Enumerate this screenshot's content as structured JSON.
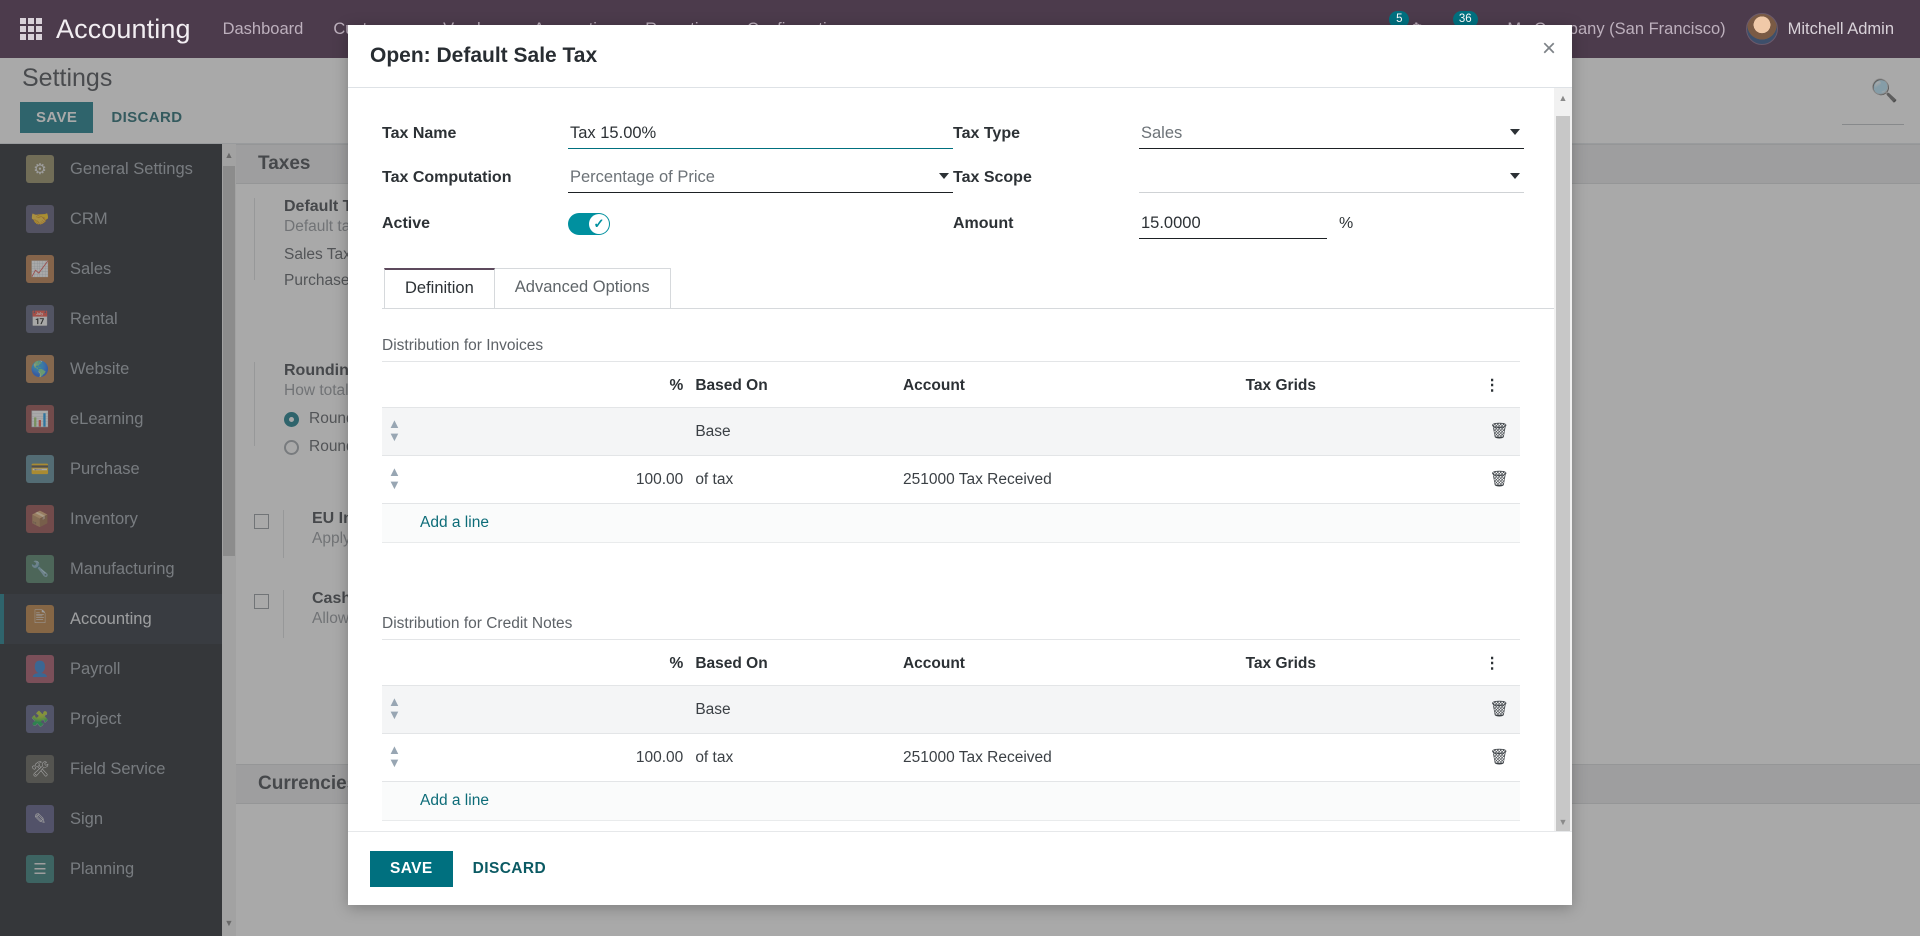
{
  "navbar": {
    "apps_icon": "apps-grid-icon",
    "brand": "Accounting",
    "menu": [
      "Dashboard",
      "Customers",
      "Vendors",
      "Accounting",
      "Reporting",
      "Configuration"
    ],
    "messages_badge": "5",
    "activities_icon": "clock-icon",
    "updates_badge": "36",
    "shortcut_icon": "scissors-icon",
    "company": "My Company (San Francisco)",
    "user": "Mitchell Admin"
  },
  "control_panel": {
    "title": "Settings",
    "save_label": "SAVE",
    "discard_label": "DISCARD",
    "search_icon": "search-icon"
  },
  "sidebar": {
    "items": [
      {
        "label": "General Settings",
        "icon": "gear-icon",
        "color": "#8a8255",
        "active": false
      },
      {
        "label": "CRM",
        "icon": "handshake-icon",
        "color": "#4b4a6b",
        "active": false
      },
      {
        "label": "Sales",
        "icon": "chart-up-icon",
        "color": "#b5703a",
        "active": false
      },
      {
        "label": "Rental",
        "icon": "calendar-icon",
        "color": "#4a4f6e",
        "active": false
      },
      {
        "label": "Website",
        "icon": "globe-icon",
        "color": "#b57842",
        "active": false
      },
      {
        "label": "eLearning",
        "icon": "presentation-icon",
        "color": "#8c3b3b",
        "active": false
      },
      {
        "label": "Purchase",
        "icon": "card-icon",
        "color": "#4c7f91",
        "active": false
      },
      {
        "label": "Inventory",
        "icon": "box-icon",
        "color": "#8c3b3b",
        "active": false
      },
      {
        "label": "Manufacturing",
        "icon": "wrench-icon",
        "color": "#3f7458",
        "active": false
      },
      {
        "label": "Accounting",
        "icon": "invoice-icon",
        "color": "#b5732f",
        "active": true
      },
      {
        "label": "Payroll",
        "icon": "person-pay-icon",
        "color": "#a04458",
        "active": false
      },
      {
        "label": "Project",
        "icon": "puzzle-icon",
        "color": "#4a4f7a",
        "active": false
      },
      {
        "label": "Field Service",
        "icon": "tools-icon",
        "color": "#4f4f45",
        "active": false
      },
      {
        "label": "Sign",
        "icon": "signature-icon",
        "color": "#4a4a7a",
        "active": false
      },
      {
        "label": "Planning",
        "icon": "timeline-icon",
        "color": "#1f6f6b",
        "active": false
      }
    ]
  },
  "settings_page": {
    "section_taxes": "Taxes",
    "blocks": [
      {
        "title": "Default Taxes",
        "subtitle": "Default taxes applied to local transactions",
        "lines": [
          "Sales Tax",
          "Purchase Tax"
        ]
      },
      {
        "title": "Rounding Method",
        "subtitle": "How total tax amount is computed in orders and invoices",
        "options": [
          "Round per Line",
          "Round Globally"
        ],
        "selected_index": 0
      },
      {
        "title": "EU Intra-community Distance Selling",
        "subtitle": "Apply VAT of the EU country to which goods are delivered."
      },
      {
        "title": "Cash Basis",
        "subtitle": "Allow to configure taxes using cash basis"
      }
    ],
    "section_currencies": "Currencies"
  },
  "modal": {
    "title": "Open: Default Sale Tax",
    "close_icon": "close-icon",
    "fields": {
      "tax_name_label": "Tax Name",
      "tax_name_value": "Tax 15.00%",
      "tax_computation_label": "Tax Computation",
      "tax_computation_value": "Percentage of Price",
      "active_label": "Active",
      "active_on": true,
      "tax_type_label": "Tax Type",
      "tax_type_value": "Sales",
      "tax_scope_label": "Tax Scope",
      "tax_scope_value": "",
      "amount_label": "Amount",
      "amount_value": "15.0000",
      "amount_suffix": "%"
    },
    "tabs": [
      {
        "label": "Definition",
        "active": true
      },
      {
        "label": "Advanced Options",
        "active": false
      }
    ],
    "distributions": [
      {
        "title": "Distribution for Invoices",
        "columns": [
          "",
          "",
          "%",
          "Based On",
          "Account",
          "Tax Grids",
          ""
        ],
        "rows": [
          {
            "pct": "",
            "based_on": "Base",
            "account": "",
            "tax_grids": ""
          },
          {
            "pct": "100.00",
            "based_on": "of tax",
            "account": "251000 Tax Received",
            "tax_grids": ""
          }
        ],
        "add_line": "Add a line"
      },
      {
        "title": "Distribution for Credit Notes",
        "columns": [
          "",
          "",
          "%",
          "Based On",
          "Account",
          "Tax Grids",
          ""
        ],
        "rows": [
          {
            "pct": "",
            "based_on": "Base",
            "account": "",
            "tax_grids": ""
          },
          {
            "pct": "100.00",
            "based_on": "of tax",
            "account": "251000 Tax Received",
            "tax_grids": ""
          }
        ],
        "add_line": "Add a line"
      }
    ],
    "footer": {
      "save_label": "SAVE",
      "discard_label": "DISCARD"
    }
  },
  "colors": {
    "accent": "#00707f",
    "navbar": "#4c3b4c",
    "sidebar": "#0d1117"
  }
}
